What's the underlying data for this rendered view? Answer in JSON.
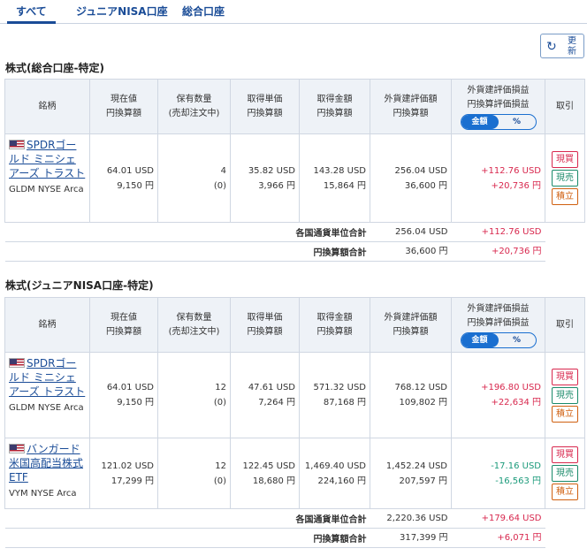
{
  "tabs": [
    {
      "label": "すべて",
      "active": true
    },
    {
      "label": "ジュニアNISA口座",
      "active": false
    },
    {
      "label": "総合口座",
      "active": false
    }
  ],
  "refresh": {
    "label": "更新"
  },
  "columns": {
    "name": "銘柄",
    "price_l1": "現在値",
    "price_l2": "円換算額",
    "qty_l1": "保有数量",
    "qty_l2": "(売却注文中)",
    "cost_l1": "取得単価",
    "cost_l2": "円換算額",
    "cost_total_l1": "取得金額",
    "cost_total_l2": "円換算額",
    "value_l1": "外貨建評価額",
    "value_l2": "円換算額",
    "pl_l1": "外貨建評価損益",
    "pl_l2": "円換算評価損益",
    "toggle_amount": "金額",
    "toggle_pct": "%",
    "trade": "取引"
  },
  "actions": {
    "buy": "現買",
    "sell": "現売",
    "tsumi": "積立"
  },
  "sections": [
    {
      "title": "株式(総合口座-特定)",
      "rows": [
        {
          "name": "SPDRゴールド ミニシェアーズ トラスト",
          "ticker": "GLDM NYSE Arca",
          "price": "64.01 USD",
          "price_jpy": "9,150 円",
          "qty": "4",
          "qty_pending": "(0)",
          "cost": "35.82 USD",
          "cost_jpy": "3,966 円",
          "cost_total": "143.28 USD",
          "cost_total_jpy": "15,864 円",
          "value": "256.04 USD",
          "value_jpy": "36,600 円",
          "pl": "+112.76 USD",
          "pl_jpy": "+20,736 円",
          "sign": "pos"
        }
      ],
      "totals": {
        "fx_label": "各国通貨単位合計",
        "fx_value": "256.04 USD",
        "fx_pl": "+112.76 USD",
        "fx_sign": "pos",
        "jpy_label": "円換算額合計",
        "jpy_value": "36,600 円",
        "jpy_pl": "+20,736 円",
        "jpy_sign": "pos"
      }
    },
    {
      "title": "株式(ジュニアNISA口座-特定)",
      "rows": [
        {
          "name": "SPDRゴールド ミニシェアーズ トラスト",
          "ticker": "GLDM NYSE Arca",
          "price": "64.01 USD",
          "price_jpy": "9,150 円",
          "qty": "12",
          "qty_pending": "(0)",
          "cost": "47.61 USD",
          "cost_jpy": "7,264 円",
          "cost_total": "571.32 USD",
          "cost_total_jpy": "87,168 円",
          "value": "768.12 USD",
          "value_jpy": "109,802 円",
          "pl": "+196.80 USD",
          "pl_jpy": "+22,634 円",
          "sign": "pos"
        },
        {
          "name": "バンガード米国高配当株式ETF",
          "ticker": "VYM NYSE Arca",
          "price": "121.02 USD",
          "price_jpy": "17,299 円",
          "qty": "12",
          "qty_pending": "(0)",
          "cost": "122.45 USD",
          "cost_jpy": "18,680 円",
          "cost_total": "1,469.40 USD",
          "cost_total_jpy": "224,160 円",
          "value": "1,452.24 USD",
          "value_jpy": "207,597 円",
          "pl": "-17.16 USD",
          "pl_jpy": "-16,563 円",
          "sign": "neg"
        }
      ],
      "totals": {
        "fx_label": "各国通貨単位合計",
        "fx_value": "2,220.36 USD",
        "fx_pl": "+179.64 USD",
        "fx_sign": "pos",
        "jpy_label": "円換算額合計",
        "jpy_value": "317,399 円",
        "jpy_pl": "+6,071 円",
        "jpy_sign": "pos"
      }
    }
  ],
  "colors": {
    "accent": "#1a4c97",
    "positive": "#d8284e",
    "negative": "#1a9a7a",
    "header_bg": "#eef2f7"
  }
}
